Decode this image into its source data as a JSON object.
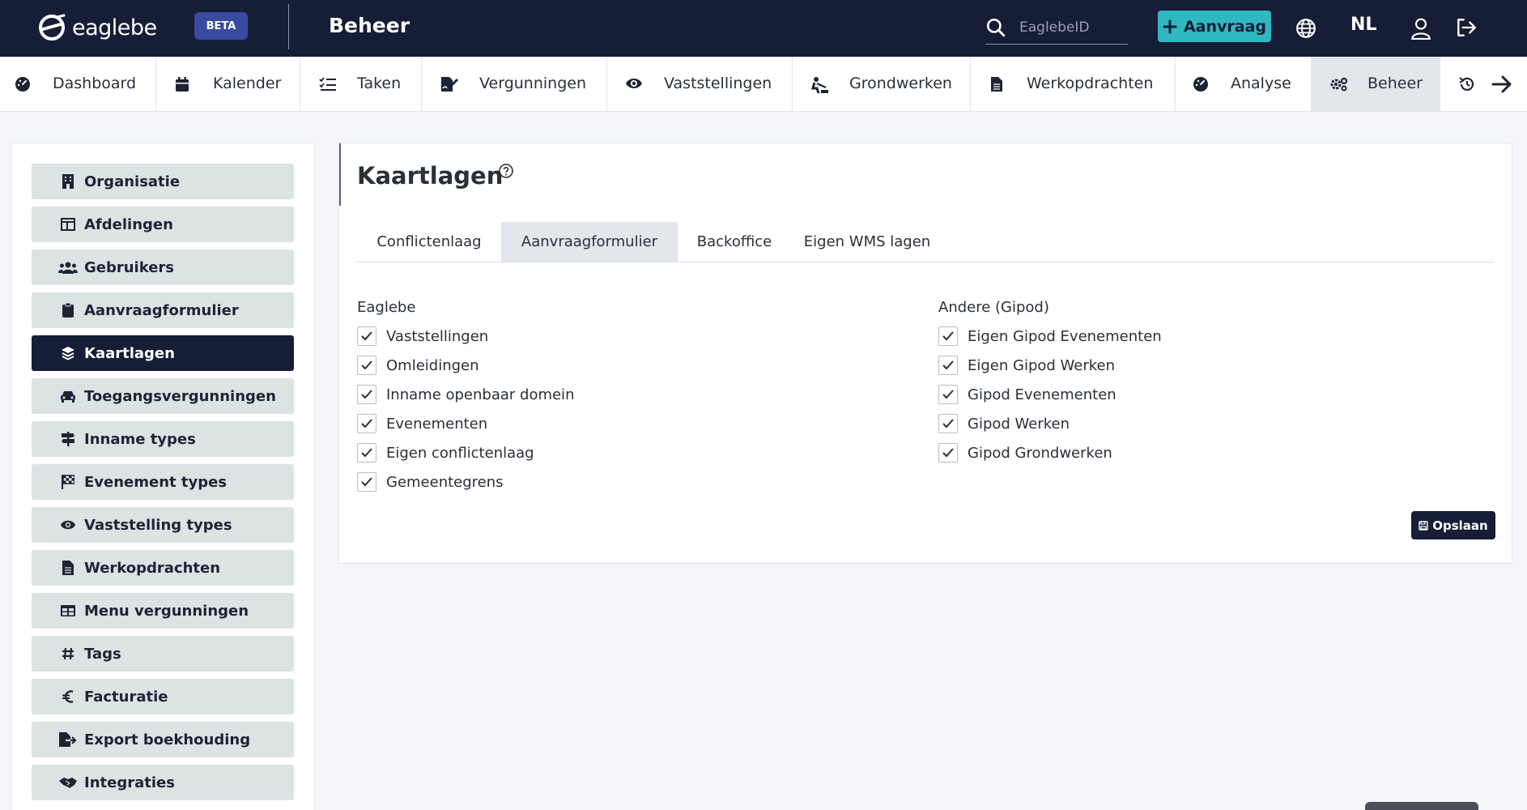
{
  "header": {
    "logo_text": "eaglebe",
    "beta_badge": "BETA",
    "title": "Beheer",
    "search_placeholder": "EaglebeID",
    "new_request_label": "Aanvraag",
    "language": "NL"
  },
  "nav": {
    "items": [
      {
        "label": "Dashboard",
        "icon": "dashboard-gauge-icon"
      },
      {
        "label": "Kalender",
        "icon": "calendar-icon"
      },
      {
        "label": "Taken",
        "icon": "task-list-icon"
      },
      {
        "label": "Vergunningen",
        "icon": "file-signature-icon"
      },
      {
        "label": "Vaststellingen",
        "icon": "eye-icon"
      },
      {
        "label": "Grondwerken",
        "icon": "digging-icon"
      },
      {
        "label": "Werkopdrachten",
        "icon": "document-icon"
      },
      {
        "label": "Analyse",
        "icon": "gauge-icon"
      },
      {
        "label": "Beheer",
        "icon": "cogs-icon",
        "active": true
      }
    ]
  },
  "sidebar": {
    "items": [
      {
        "label": "Organisatie",
        "icon": "building-icon"
      },
      {
        "label": "Afdelingen",
        "icon": "layout-icon"
      },
      {
        "label": "Gebruikers",
        "icon": "users-icon"
      },
      {
        "label": "Aanvraagformulier",
        "icon": "clipboard-icon"
      },
      {
        "label": "Kaartlagen",
        "icon": "layers-icon",
        "active": true
      },
      {
        "label": "Toegangsvergunningen",
        "icon": "car-icon"
      },
      {
        "label": "Inname types",
        "icon": "signpost-icon"
      },
      {
        "label": "Evenement types",
        "icon": "flag-checkered-icon"
      },
      {
        "label": "Vaststelling types",
        "icon": "eye-icon"
      },
      {
        "label": "Werkopdrachten",
        "icon": "document-icon"
      },
      {
        "label": "Menu vergunningen",
        "icon": "table-icon"
      },
      {
        "label": "Tags",
        "icon": "hashtag-icon"
      },
      {
        "label": "Facturatie",
        "icon": "euro-icon"
      },
      {
        "label": "Export boekhouding",
        "icon": "file-export-icon"
      },
      {
        "label": "Integraties",
        "icon": "handshake-icon"
      }
    ]
  },
  "main": {
    "title": "Kaartlagen",
    "tabs": [
      {
        "label": "Conflictenlaag"
      },
      {
        "label": "Aanvraagformulier",
        "active": true
      },
      {
        "label": "Backoffice"
      },
      {
        "label": "Eigen WMS lagen"
      }
    ],
    "columns": [
      {
        "title": "Eaglebe",
        "items": [
          {
            "label": "Vaststellingen",
            "checked": true
          },
          {
            "label": "Omleidingen",
            "checked": true
          },
          {
            "label": "Inname openbaar domein",
            "checked": true
          },
          {
            "label": "Evenementen",
            "checked": true
          },
          {
            "label": "Eigen conflictenlaag",
            "checked": true
          },
          {
            "label": "Gemeentegrens",
            "checked": true
          }
        ]
      },
      {
        "title": "Andere (Gipod)",
        "items": [
          {
            "label": "Eigen Gipod Evenementen",
            "checked": true
          },
          {
            "label": "Eigen Gipod Werken",
            "checked": true
          },
          {
            "label": "Gipod Evenementen",
            "checked": true
          },
          {
            "label": "Gipod Werken",
            "checked": true
          },
          {
            "label": "Gipod Grondwerken",
            "checked": true
          }
        ]
      }
    ],
    "save_label": "Opslaan"
  },
  "colors": {
    "header_bg": "#161d36",
    "accent": "#2fb8c0",
    "beta_bg": "#3a4aa0",
    "sidebar_item_bg": "#dbe3e3",
    "active_bg": "#161d36"
  }
}
